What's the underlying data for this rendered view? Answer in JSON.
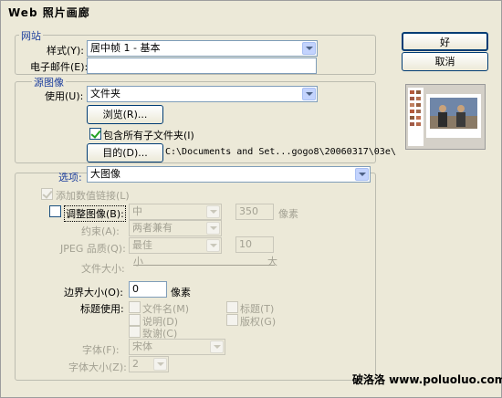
{
  "window": {
    "title": "Web 照片画廊"
  },
  "site": {
    "legend": "网站",
    "style_label": "样式(Y):",
    "style_value": "居中帧 1 - 基本",
    "email_label": "电子邮件(E):",
    "email_value": ""
  },
  "source": {
    "legend": "源图像",
    "use_label": "使用(U):",
    "use_value": "文件夹",
    "browse_button": "浏览(R)...",
    "include_sub_label": "包含所有子文件夹(I)",
    "include_sub_checked": true,
    "dest_button": "目的(D)...",
    "dest_path": "C:\\Documents and Set...gogo8\\20060317\\03e\\"
  },
  "options": {
    "label": "选项:",
    "value": "大图像",
    "add_links_label": "添加数值链接(L)",
    "resize_label": "调整图像(B):",
    "resize_value": "中",
    "resize_px": "350",
    "px_unit": "像素",
    "constrain_label": "约束(A):",
    "constrain_value": "两者兼有",
    "jpeg_label": "JPEG 品质(Q):",
    "jpeg_value": "最佳",
    "jpeg_num": "10",
    "filesize_label": "文件大小:",
    "small": "小",
    "large": "大",
    "border_label": "边界大小(O):",
    "border_value": "0",
    "border_unit": "像素",
    "titles_label": "标题使用:",
    "filename": "文件名(M)",
    "title": "标题(T)",
    "desc": "说明(D)",
    "copyright": "版权(G)",
    "credits": "致谢(C)",
    "font_label": "字体(F):",
    "font_value": "宋体",
    "fontsize_label": "字体大小(Z):",
    "fontsize_value": "2"
  },
  "buttons": {
    "ok": "好",
    "cancel": "取消"
  },
  "watermark": "破洛洛 www.poluoluo.com"
}
